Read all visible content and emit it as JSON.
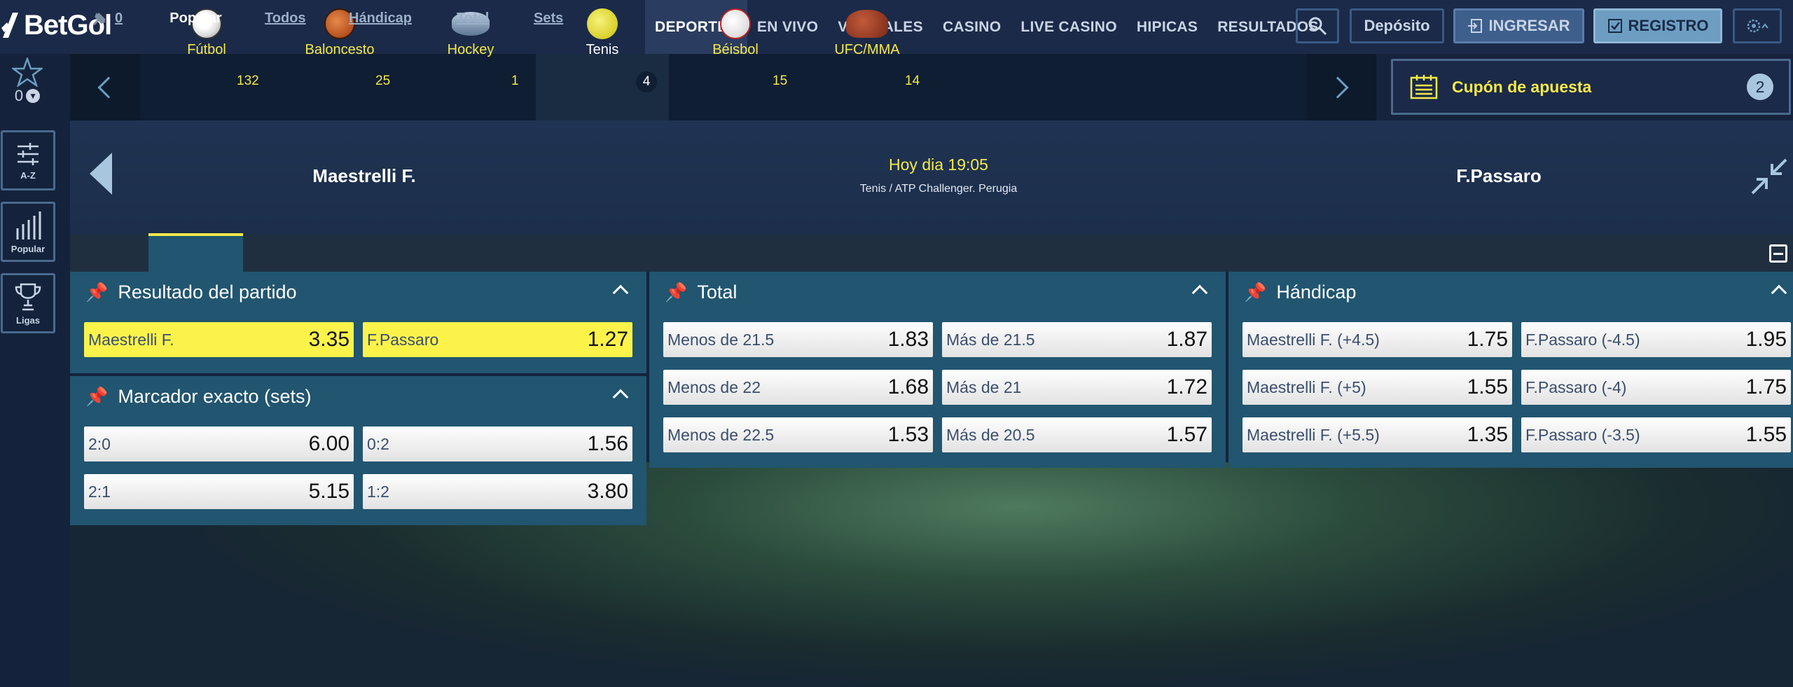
{
  "brand": {
    "name": "BetGol"
  },
  "nav": [
    "DEPORTES",
    "EN VIVO",
    "VIRTUALES",
    "CASINO",
    "LIVE CASINO",
    "HIPICAS",
    "RESULTADOS"
  ],
  "header_buttons": {
    "deposit": "Depósito",
    "login": "INGRESAR",
    "register": "REGISTRO"
  },
  "favorites": {
    "count": "0"
  },
  "rail": {
    "az": "A-Z",
    "popular": "Popular",
    "leagues": "Ligas"
  },
  "sports": [
    {
      "name": "Fútbol",
      "count": "132",
      "icon": "soccer-ball-icon"
    },
    {
      "name": "Baloncesto",
      "count": "25",
      "icon": "basketball-icon"
    },
    {
      "name": "Hockey",
      "count": "1",
      "icon": "hockey-puck-icon"
    },
    {
      "name": "Tenis",
      "count": "4",
      "icon": "tennis-ball-icon"
    },
    {
      "name": "Béisbol",
      "count": "15",
      "icon": "baseball-icon"
    },
    {
      "name": "UFC/MMA",
      "count": "14",
      "icon": "boxing-glove-icon"
    }
  ],
  "coupon": {
    "label": "Cupón de apuesta",
    "count": "2"
  },
  "match": {
    "home": "Maestrelli F.",
    "away": "F.Passaro",
    "time": "Hoy dia 19:05",
    "league": "Tenis / ATP Challenger. Perugia"
  },
  "tabs": {
    "pinned_count": "0",
    "items": [
      "Popular",
      "Todos",
      "Hándicap",
      "Total",
      "Sets"
    ],
    "active": "Popular"
  },
  "markets": {
    "result": {
      "title": "Resultado del partido",
      "odds": [
        {
          "name": "Maestrelli F.",
          "value": "3.35"
        },
        {
          "name": "F.Passaro",
          "value": "1.27"
        }
      ]
    },
    "exact": {
      "title": "Marcador exacto (sets)",
      "odds": [
        {
          "name": "2:0",
          "value": "6.00"
        },
        {
          "name": "0:2",
          "value": "1.56"
        },
        {
          "name": "2:1",
          "value": "5.15"
        },
        {
          "name": "1:2",
          "value": "3.80"
        }
      ]
    },
    "total": {
      "title": "Total",
      "odds": [
        {
          "name": "Menos de 21.5",
          "value": "1.83"
        },
        {
          "name": "Más de 21.5",
          "value": "1.87"
        },
        {
          "name": "Menos de 22",
          "value": "1.68"
        },
        {
          "name": "Más de 21",
          "value": "1.72"
        },
        {
          "name": "Menos de 22.5",
          "value": "1.53"
        },
        {
          "name": "Más de 20.5",
          "value": "1.57"
        }
      ]
    },
    "handicap": {
      "title": "Hándicap",
      "odds": [
        {
          "name": "Maestrelli F. (+4.5)",
          "value": "1.75"
        },
        {
          "name": "F.Passaro (-4.5)",
          "value": "1.95"
        },
        {
          "name": "Maestrelli F. (+5)",
          "value": "1.55"
        },
        {
          "name": "F.Passaro (-4)",
          "value": "1.75"
        },
        {
          "name": "Maestrelli F. (+5.5)",
          "value": "1.35"
        },
        {
          "name": "F.Passaro (-3.5)",
          "value": "1.55"
        }
      ]
    }
  },
  "colors": {
    "accent": "#f4e94a",
    "selected_odd": "#fbf34a",
    "market_bg": "#215570"
  }
}
